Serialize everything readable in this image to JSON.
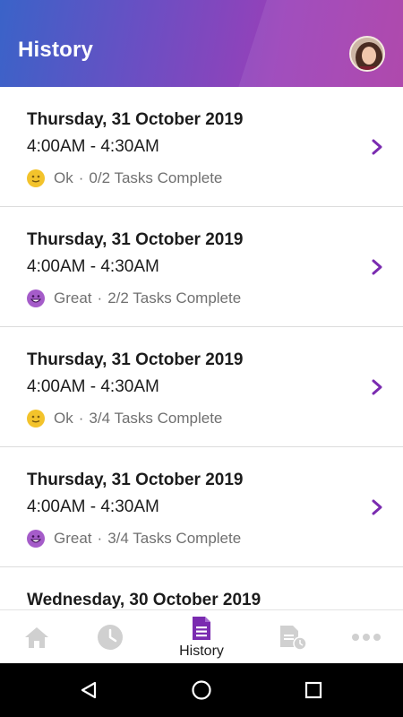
{
  "header": {
    "title": "History"
  },
  "history": [
    {
      "date": "Thursday, 31 October 2019",
      "time": "4:00AM - 4:30AM",
      "mood": "Ok",
      "mood_type": "ok",
      "tasks": "0/2 Tasks Complete",
      "separator": "·"
    },
    {
      "date": "Thursday, 31 October 2019",
      "time": "4:00AM - 4:30AM",
      "mood": "Great",
      "mood_type": "great",
      "tasks": "2/2 Tasks Complete",
      "separator": "·"
    },
    {
      "date": "Thursday, 31 October 2019",
      "time": "4:00AM - 4:30AM",
      "mood": "Ok",
      "mood_type": "ok",
      "tasks": "3/4 Tasks Complete",
      "separator": "·"
    },
    {
      "date": "Thursday, 31 October 2019",
      "time": "4:00AM - 4:30AM",
      "mood": "Great",
      "mood_type": "great",
      "tasks": "3/4 Tasks Complete",
      "separator": "·"
    },
    {
      "date": "Wednesday, 30 October 2019"
    }
  ],
  "bottom_nav": {
    "active_label": "History",
    "items": [
      {
        "icon": "home-icon"
      },
      {
        "icon": "clock-icon"
      },
      {
        "icon": "history-document-icon",
        "label": "History",
        "active": true
      },
      {
        "icon": "report-clock-icon"
      },
      {
        "icon": "more-icon"
      }
    ]
  },
  "colors": {
    "accent": "#7a2bb0",
    "ok_emoji": "#f3c32b",
    "great_emoji": "#a55cc9",
    "inactive_icon": "#d0d0d0"
  },
  "system_nav": {
    "icons": [
      "back-icon",
      "home-circle-icon",
      "recents-icon"
    ]
  }
}
